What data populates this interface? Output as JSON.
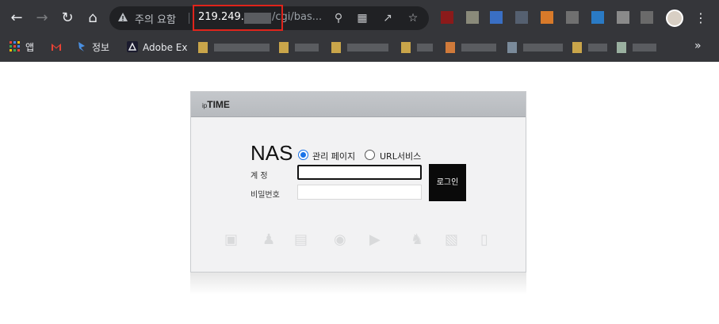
{
  "browser": {
    "security_label": "주의 요함",
    "url_host": "219.249.",
    "url_path": "/cgi/bas...",
    "bookmarks": [
      {
        "label": "앱"
      },
      {
        "label": ""
      },
      {
        "label": "정보"
      },
      {
        "label": "Adobe Ex"
      }
    ]
  },
  "panel": {
    "logo_prefix": "ip",
    "logo_main": "TIME",
    "title": "NAS",
    "radio_admin": "관리 페이지",
    "radio_url": "URL서비스",
    "account_label": "계 정",
    "password_label": "비밀번호",
    "login_label": "로그인"
  },
  "colors": {
    "chrome_bg": "#35363a",
    "omnibox_bg": "#202124",
    "highlight": "#e0241b",
    "accent": "#1a73e8"
  }
}
